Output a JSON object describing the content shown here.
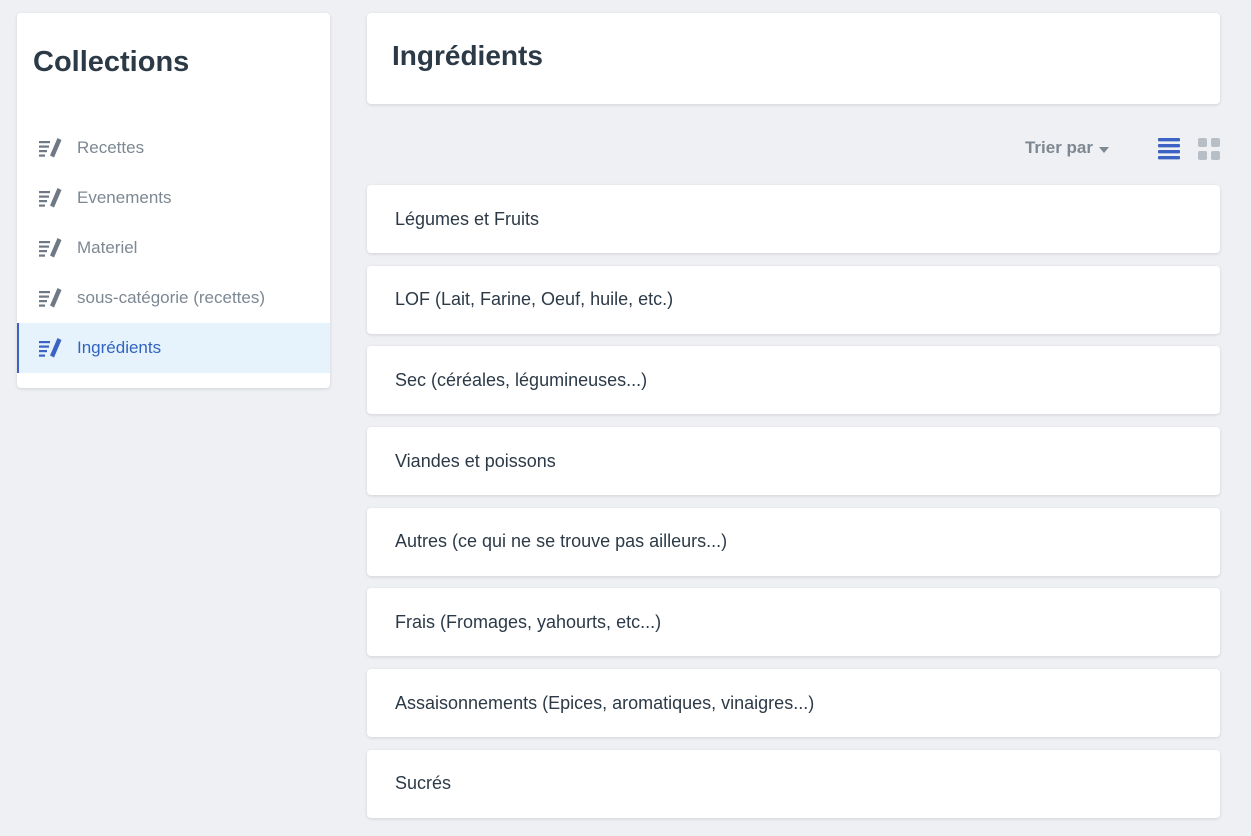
{
  "sidebar": {
    "title": "Collections",
    "items": [
      {
        "label": "Recettes",
        "icon": "edit-list-icon",
        "active": false
      },
      {
        "label": "Evenements",
        "icon": "edit-list-icon",
        "active": false
      },
      {
        "label": "Materiel",
        "icon": "edit-list-icon",
        "active": false
      },
      {
        "label": "sous-catégorie (recettes)",
        "icon": "edit-list-icon",
        "active": false
      },
      {
        "label": "Ingrédients",
        "icon": "edit-list-icon",
        "active": true
      }
    ]
  },
  "main": {
    "title": "Ingrédients",
    "toolbar": {
      "sort_label": "Trier par",
      "list_view_icon": "list-view-icon",
      "grid_view_icon": "grid-view-icon",
      "active_view": "list"
    },
    "entries": [
      "Légumes et Fruits",
      "LOF (Lait, Farine, Oeuf, huile, etc.)",
      "Sec (céréales, légumineuses...)",
      "Viandes et poissons",
      "Autres (ce qui ne se trouve pas ailleurs...)",
      "Frais (Fromages, yahourts, etc...)",
      "Assaisonnements (Epices, aromatiques, vinaigres...)",
      "Sucrés"
    ]
  },
  "colors": {
    "accent": "#3c63c3",
    "active_bg": "#e6f3fd",
    "page_bg": "#eef0f3",
    "muted": "#7d8893"
  }
}
